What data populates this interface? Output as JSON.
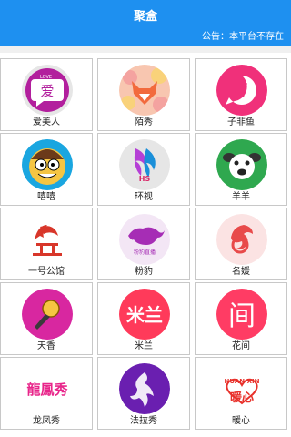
{
  "header": {
    "title": "聚盒"
  },
  "notice": {
    "text": "公告：本平台不存在"
  },
  "apps": [
    {
      "label": "爱美人",
      "icon": "heart-chat-icon",
      "color": "#c02aa8"
    },
    {
      "label": "陌秀",
      "icon": "fox-icon",
      "color": "#f26a3d"
    },
    {
      "label": "子非鱼",
      "icon": "fish-bubble-icon",
      "color": "#f0307a"
    },
    {
      "label": "嘻嘻",
      "icon": "cartoon-face-icon",
      "color": "#1aa6e0"
    },
    {
      "label": "环视",
      "icon": "flame-logo-icon",
      "color": "#1a8fd9"
    },
    {
      "label": "羊羊",
      "icon": "sheep-face-icon",
      "color": "#2fa84f"
    },
    {
      "label": "一号公馆",
      "icon": "mansion-icon",
      "color": "#d8362a"
    },
    {
      "label": "粉豹",
      "icon": "panther-icon",
      "color": "#a62db5"
    },
    {
      "label": "名媛",
      "icon": "swirl-logo-icon",
      "color": "#e84a4a"
    },
    {
      "label": "天香",
      "icon": "microphone-icon",
      "color": "#d827a0"
    },
    {
      "label": "米兰",
      "icon": "milan-text-icon",
      "color": "#ff3a5a"
    },
    {
      "label": "花间",
      "icon": "door-text-icon",
      "color": "#ff3c64"
    },
    {
      "label": "龙凤秀",
      "icon": "dragon-phoenix-icon",
      "color": "#ffffff"
    },
    {
      "label": "法拉秀",
      "icon": "dancer-icon",
      "color": "#6a1fb0"
    },
    {
      "label": "暖心",
      "icon": "warm-heart-icon",
      "color": "#ffffff"
    }
  ],
  "icon_text": {
    "lp": "LOVE",
    "pl": "粉豹直播",
    "ml": "米兰",
    "jian": "间",
    "lfx": "龍鳳秀",
    "nx": "NUAN XIN",
    "nx_cn": "暖心",
    "ai": "爱",
    "hs": "HS"
  }
}
